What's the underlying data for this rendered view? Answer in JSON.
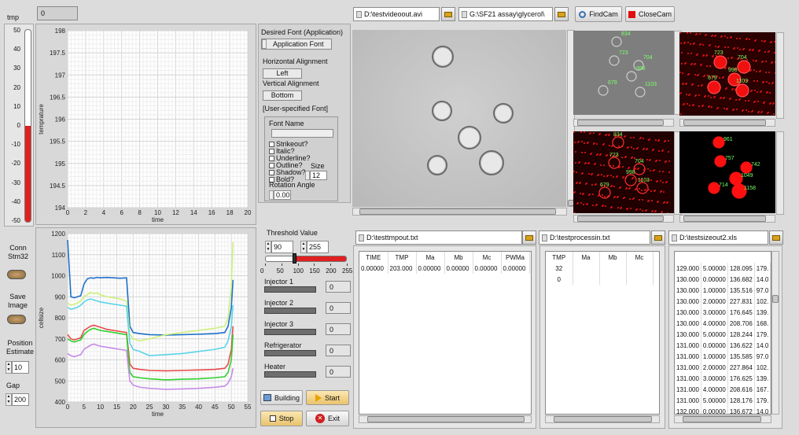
{
  "top_numeric": "0",
  "tmp": {
    "label": "tmp",
    "ticks": [
      "50",
      "40",
      "30",
      "20",
      "10",
      "0",
      "-10",
      "-20",
      "-30",
      "-40",
      "-50"
    ],
    "value": 0,
    "min": -50,
    "max": 50
  },
  "left_controls": {
    "conn_label": "Conn\nStm32",
    "save_label": "Save\nImage",
    "position_label": "Position\nEstimate",
    "position_value": "10",
    "gap_label": "Gap",
    "gap_value": "200"
  },
  "chart_data": [
    {
      "type": "line",
      "title": "",
      "xlabel": "time",
      "ylabel": "temprature",
      "xlim": [
        0,
        20
      ],
      "ylim": [
        194,
        198
      ],
      "x_ticks": [
        "0",
        "2",
        "4",
        "6",
        "8",
        "10",
        "12",
        "14",
        "16",
        "18",
        "20"
      ],
      "y_ticks": [
        "198",
        "197.5",
        "197",
        "196.5",
        "196",
        "195.5",
        "195",
        "194.5",
        "194"
      ],
      "series": []
    },
    {
      "type": "line",
      "title": "",
      "xlabel": "time",
      "ylabel": "cellsize",
      "xlim": [
        0,
        55
      ],
      "ylim": [
        400,
        1200
      ],
      "x_ticks": [
        "0",
        "5",
        "10",
        "15",
        "20",
        "25",
        "30",
        "35",
        "40",
        "45",
        "50",
        "55"
      ],
      "y_ticks": [
        "1200",
        "1100",
        "1000",
        "900",
        "800",
        "700",
        "600",
        "500",
        "400"
      ],
      "series": [
        {
          "color": "#1e6fc8",
          "x": [
            0,
            1,
            2,
            3,
            4,
            5,
            6,
            7,
            8,
            9,
            10,
            12,
            14,
            16,
            18,
            19,
            20,
            22,
            25,
            30,
            35,
            40,
            45,
            48,
            49,
            50,
            50.5
          ],
          "values": [
            1170,
            900,
            895,
            900,
            905,
            960,
            985,
            990,
            988,
            992,
            990,
            992,
            990,
            988,
            990,
            760,
            730,
            725,
            720,
            718,
            720,
            722,
            725,
            730,
            760,
            850,
            980
          ]
        },
        {
          "color": "#cff07a",
          "x": [
            0,
            1,
            2,
            3,
            4,
            5,
            6,
            7,
            8,
            9,
            10,
            12,
            14,
            16,
            18,
            19,
            20,
            22,
            25,
            30,
            35,
            40,
            45,
            48,
            49,
            50,
            50.5
          ],
          "values": [
            870,
            860,
            865,
            870,
            880,
            900,
            910,
            920,
            915,
            918,
            910,
            900,
            895,
            890,
            880,
            720,
            700,
            690,
            700,
            720,
            730,
            740,
            750,
            760,
            800,
            950,
            1160
          ]
        },
        {
          "color": "#5ad4e8",
          "x": [
            0,
            1,
            2,
            3,
            4,
            5,
            6,
            7,
            8,
            9,
            10,
            12,
            14,
            16,
            18,
            19,
            20,
            22,
            25,
            30,
            35,
            40,
            45,
            48,
            49,
            50,
            50.5
          ],
          "values": [
            850,
            840,
            845,
            850,
            860,
            875,
            885,
            890,
            885,
            880,
            875,
            870,
            865,
            860,
            855,
            680,
            650,
            640,
            620,
            625,
            630,
            640,
            650,
            660,
            690,
            760,
            860
          ]
        },
        {
          "color": "#e84a4a",
          "x": [
            0,
            1,
            2,
            3,
            4,
            5,
            6,
            7,
            8,
            9,
            10,
            12,
            14,
            16,
            18,
            19,
            20,
            22,
            25,
            30,
            35,
            40,
            45,
            48,
            49,
            50,
            50.5
          ],
          "values": [
            720,
            700,
            695,
            700,
            705,
            740,
            750,
            760,
            765,
            760,
            755,
            745,
            740,
            735,
            730,
            580,
            560,
            555,
            550,
            548,
            550,
            552,
            555,
            560,
            580,
            650,
            760
          ]
        },
        {
          "color": "#2fd02f",
          "x": [
            0,
            1,
            2,
            3,
            4,
            5,
            6,
            7,
            8,
            9,
            10,
            12,
            14,
            16,
            18,
            19,
            20,
            22,
            25,
            30,
            35,
            40,
            45,
            48,
            49,
            50,
            50.5
          ],
          "values": [
            700,
            690,
            685,
            690,
            695,
            720,
            735,
            745,
            750,
            745,
            740,
            735,
            730,
            725,
            720,
            540,
            520,
            515,
            510,
            505,
            508,
            510,
            515,
            520,
            540,
            600,
            720
          ]
        },
        {
          "color": "#c88ae8",
          "x": [
            0,
            1,
            2,
            3,
            4,
            5,
            6,
            7,
            8,
            9,
            10,
            12,
            14,
            16,
            18,
            19,
            20,
            22,
            25,
            30,
            35,
            40,
            45,
            48,
            49,
            50,
            50.5
          ],
          "values": [
            630,
            620,
            615,
            620,
            625,
            650,
            660,
            670,
            675,
            670,
            665,
            660,
            655,
            650,
            645,
            500,
            480,
            470,
            465,
            460,
            462,
            465,
            470,
            475,
            490,
            520,
            560
          ]
        }
      ]
    }
  ],
  "font_panel": {
    "desired_font_label": "Desired Font (Application)",
    "desired_font_value": "Application Font",
    "h_align_label": "Horizontal Alignment",
    "h_align_value": "Left",
    "v_align_label": "Vertical Alignment",
    "v_align_value": "Bottom",
    "user_font_label": "[User-specified Font]",
    "font_name_label": "Font Name",
    "checks": [
      "Strikeout?",
      "Italic?",
      "Underline?",
      "Outline?",
      "Shadow?",
      "Bold?"
    ],
    "size_label": "Size",
    "size_value": "12",
    "rotation_label": "Rotation Angle",
    "rotation_value": "0.00"
  },
  "threshold": {
    "label": "Threshold Value",
    "low": "90",
    "high": "255",
    "ticks": [
      "0",
      "50",
      "100",
      "150",
      "200",
      "255"
    ],
    "low_value": 90,
    "high_value": 255
  },
  "devices": [
    {
      "label": "Injector 1",
      "value": "0"
    },
    {
      "label": "Injector 2",
      "value": "0"
    },
    {
      "label": "Injector 3",
      "value": "0"
    },
    {
      "label": "Refrigerator",
      "value": "0"
    },
    {
      "label": "Heater",
      "value": "0"
    }
  ],
  "buttons": {
    "building": "Building",
    "start": "Start",
    "stop": "Stop",
    "exit": "Exit",
    "findcam": "FindCam",
    "closecam": "CloseCam"
  },
  "paths": {
    "video": "D:\\testvideoout.avi",
    "assay": "G:\\SF21 assay\\glycerol\\",
    "tmp": "D:\\testtmpout.txt",
    "process": "D:\\testprocessin.txt",
    "size": "D:\\testsizeout2.xls"
  },
  "table_tmp": {
    "headers": [
      "TIME",
      "TMP",
      "Ma",
      "Mb",
      "Mc",
      "PWMa"
    ],
    "rows": [
      [
        "0.00000",
        "203.000",
        "0.00000",
        "0.00000",
        "0.00000",
        "0.00000"
      ]
    ]
  },
  "table_process": {
    "headers": [
      "TMP",
      "Ma",
      "Mb",
      "Mc"
    ],
    "rows": [
      [
        "32",
        "",
        "",
        ""
      ],
      [
        "0",
        "",
        "",
        ""
      ]
    ]
  },
  "table_size": {
    "rows": [
      [
        "129.000",
        "5.00000",
        "128.095",
        "179."
      ],
      [
        "130.000",
        "0.00000",
        "136.682",
        "14.0"
      ],
      [
        "130.000",
        "1.00000",
        "135.516",
        "97.0"
      ],
      [
        "130.000",
        "2.00000",
        "227.831",
        "102."
      ],
      [
        "130.000",
        "3.00000",
        "176.645",
        "139."
      ],
      [
        "130.000",
        "4.00000",
        "208.706",
        "168."
      ],
      [
        "130.000",
        "5.00000",
        "128.244",
        "179."
      ],
      [
        "131.000",
        "0.00000",
        "136.622",
        "14.0"
      ],
      [
        "131.000",
        "1.00000",
        "135.585",
        "97.0"
      ],
      [
        "131.000",
        "2.00000",
        "227.864",
        "102."
      ],
      [
        "131.000",
        "3.00000",
        "176.625",
        "139."
      ],
      [
        "131.000",
        "4.00000",
        "208.616",
        "167."
      ],
      [
        "131.000",
        "5.00000",
        "128.176",
        "179."
      ],
      [
        "132.000",
        "0.00000",
        "136.672",
        "14.0"
      ]
    ]
  },
  "cells_main": [
    "",
    "",
    "",
    "",
    "",
    "",
    ""
  ],
  "cam_labels": {
    "gray": [
      "834",
      "723",
      "704",
      "998",
      "679",
      "1103"
    ],
    "red_top": [
      "723",
      "704",
      "998",
      "679",
      "1103"
    ],
    "red_bottom": [
      "834",
      "723",
      "704",
      "998",
      "679",
      "1103"
    ],
    "black": [
      "961",
      "757",
      "742",
      "1049",
      "714",
      "1158"
    ]
  }
}
